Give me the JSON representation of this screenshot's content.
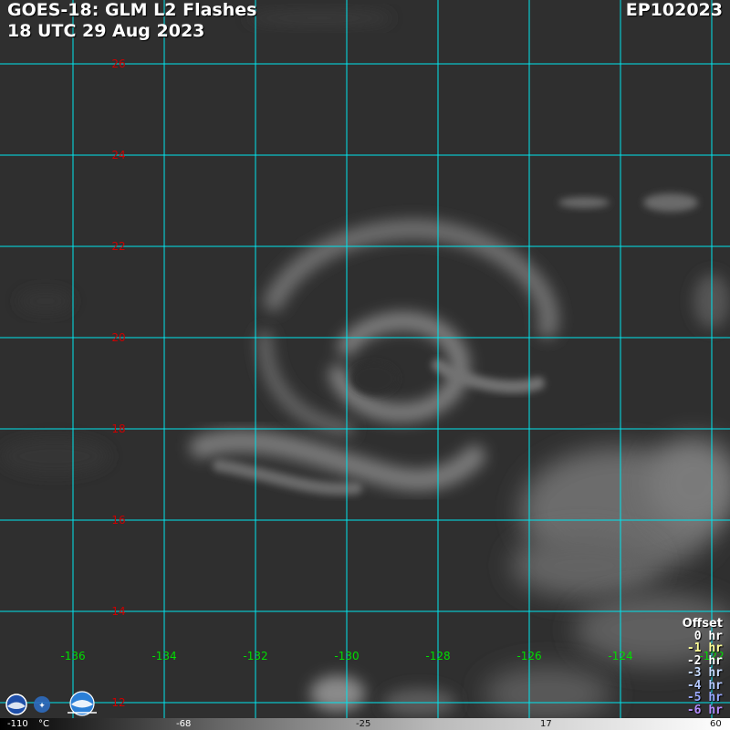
{
  "header": {
    "title_line1": "GOES-18: GLM L2 Flashes",
    "title_line2": "18 UTC 29 Aug 2023",
    "storm_id": "EP102023"
  },
  "grid": {
    "latitudes": [
      "26",
      "24",
      "22",
      "20",
      "18",
      "16",
      "14",
      "12"
    ],
    "longitudes": [
      "-136",
      "-134",
      "-132",
      "-130",
      "-128",
      "-126",
      "-124",
      "-122"
    ],
    "lat_label_color": "#cc0000",
    "lon_label_color": "#00dd00",
    "line_color": "#00e5ee"
  },
  "legend": {
    "title": "Offset",
    "items": [
      {
        "label": "0 hr",
        "color": "#ffffff"
      },
      {
        "label": "-1 hr",
        "color": "#ffff99"
      },
      {
        "label": "-2 hr",
        "color": "#ffffff"
      },
      {
        "label": "-3 hr",
        "color": "#c8dcff"
      },
      {
        "label": "-4 hr",
        "color": "#b4c8ff"
      },
      {
        "label": "-5 hr",
        "color": "#9aa8ff"
      },
      {
        "label": "-6 hr",
        "color": "#b48cff"
      }
    ]
  },
  "colorbar": {
    "min": "-110",
    "unit": "°C",
    "ticks": [
      "-68",
      "-25",
      "17"
    ],
    "max": "60"
  },
  "logos": {
    "left_logo": "noaa-logo",
    "right_logo": "cira-logo"
  }
}
